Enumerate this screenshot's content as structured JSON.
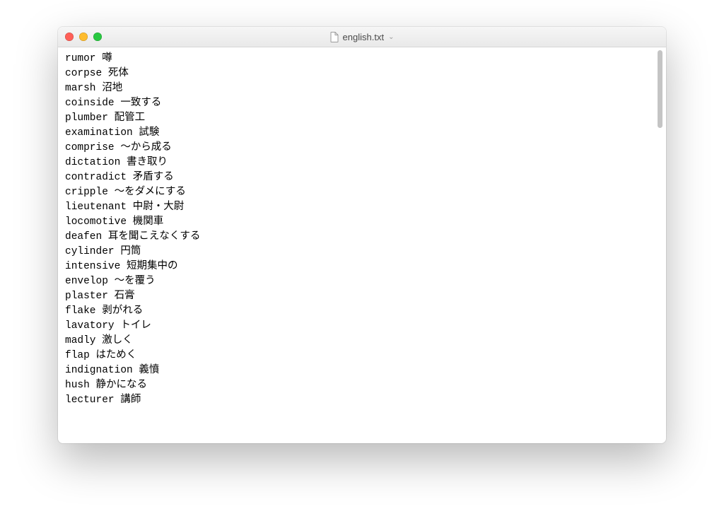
{
  "window": {
    "title": "english.txt"
  },
  "lines": [
    "rumor 噂",
    "corpse 死体",
    "marsh 沼地",
    "coinside 一致する",
    "plumber 配管工",
    "examination 試験",
    "comprise 〜から成る",
    "dictation 書き取り",
    "contradict 矛盾する",
    "cripple 〜をダメにする",
    "lieutenant 中尉・大尉",
    "locomotive 機関車",
    "deafen 耳を聞こえなくする",
    "cylinder 円筒",
    "intensive 短期集中の",
    "envelop 〜を覆う",
    "plaster 石膏",
    "flake 剥がれる",
    "lavatory トイレ",
    "madly 激しく",
    "flap はためく",
    "indignation 義憤",
    "hush 静かになる",
    "lecturer 講師"
  ]
}
